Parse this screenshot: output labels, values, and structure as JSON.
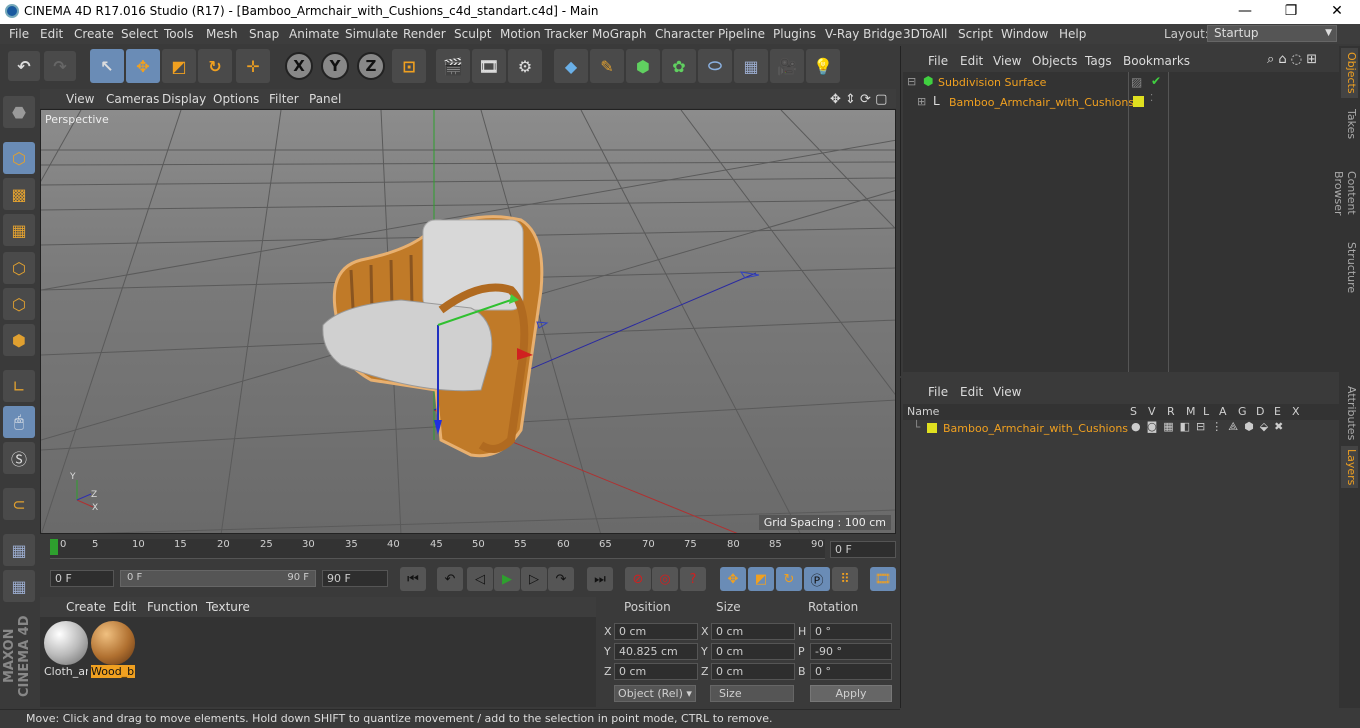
{
  "window": {
    "title": "CINEMA 4D R17.016 Studio (R17) - [Bamboo_Armchair_with_Cushions_c4d_standart.c4d] - Main",
    "minimize": "—",
    "maximize": "❐",
    "close": "✕"
  },
  "menu": [
    "File",
    "Edit",
    "Create",
    "Select",
    "Tools",
    "Mesh",
    "Snap",
    "Animate",
    "Simulate",
    "Render",
    "Sculpt",
    "Motion Tracker",
    "MoGraph",
    "Character",
    "Pipeline",
    "Plugins",
    "V-Ray Bridge",
    "3DToAll",
    "Script",
    "Window",
    "Help"
  ],
  "layout": {
    "label": "Layout:",
    "value": "Startup"
  },
  "toolbar": {
    "x_label": "X",
    "y_label": "Y",
    "z_label": "Z"
  },
  "viewport": {
    "menu": [
      "View",
      "Cameras",
      "Display",
      "Options",
      "Filter",
      "Panel"
    ],
    "camera": "Perspective",
    "grid_spacing": "Grid Spacing : 100 cm",
    "axis_y": "Y",
    "axis_x": "X",
    "axis_z": "Z"
  },
  "timeline": {
    "ticks": [
      "0",
      "5",
      "10",
      "15",
      "20",
      "25",
      "30",
      "35",
      "40",
      "45",
      "50",
      "55",
      "60",
      "65",
      "70",
      "75",
      "80",
      "85",
      "90"
    ],
    "current_frame": "0 F"
  },
  "transport": {
    "start_field": "0 F",
    "range_start": "0 F",
    "range_end": "90 F",
    "end_field": "90 F"
  },
  "materials": {
    "menu": [
      "Create",
      "Edit",
      "Function",
      "Texture"
    ],
    "items": [
      {
        "label": "Cloth_arm"
      },
      {
        "label": "Wood_b"
      }
    ]
  },
  "coords": {
    "headers": {
      "position": "Position",
      "size": "Size",
      "rotation": "Rotation"
    },
    "rows": [
      {
        "axis": "X",
        "pos": "0 cm",
        "size_axis": "X",
        "size": "0 cm",
        "rot_axis": "H",
        "rot": "0 °"
      },
      {
        "axis": "Y",
        "pos": "40.825 cm",
        "size_axis": "Y",
        "size": "0 cm",
        "rot_axis": "P",
        "rot": "-90 °"
      },
      {
        "axis": "Z",
        "pos": "0 cm",
        "size_axis": "Z",
        "size": "0 cm",
        "rot_axis": "B",
        "rot": "0 °"
      }
    ],
    "mode": "Object (Rel)",
    "size_mode": "Size",
    "apply": "Apply"
  },
  "objects": {
    "menu": [
      "File",
      "Edit",
      "View",
      "Objects",
      "Tags",
      "Bookmarks"
    ],
    "items": [
      {
        "name": "Subdivision Surface"
      },
      {
        "name": "Bamboo_Armchair_with_Cushions"
      }
    ]
  },
  "layers": {
    "menu": [
      "File",
      "Edit",
      "View"
    ],
    "columns": [
      "Name",
      "S",
      "V",
      "R",
      "M",
      "L",
      "A",
      "G",
      "D",
      "E",
      "X"
    ],
    "row": "Bamboo_Armchair_with_Cushions"
  },
  "side_tabs": [
    "Objects",
    "Takes",
    "Content Browser",
    "Structure",
    "Attributes",
    "Layers"
  ],
  "status": "Move: Click and drag to move elements. Hold down SHIFT to quantize movement / add to the selection in point mode, CTRL to remove.",
  "branding": "MAXON CINEMA 4D"
}
